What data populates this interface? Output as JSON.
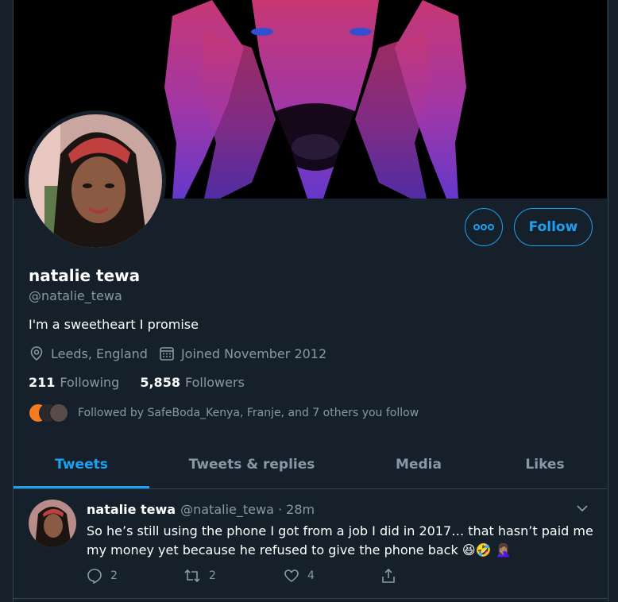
{
  "colors": {
    "accent": "#1da1f2",
    "background": "#15202b",
    "secondary_text": "#8899a6",
    "divider": "#38444d"
  },
  "profile": {
    "name": "natalie tewa",
    "handle": "@natalie_tewa",
    "bio": "I'm a sweetheart I promise",
    "location": "Leeds, England",
    "joined": "Joined November 2012",
    "following_count": "211",
    "following_label": "Following",
    "followers_count": "5,858",
    "followers_label": "Followers",
    "followed_by": "Followed by SafeBoda_Kenya, Franje, and 7 others you follow"
  },
  "buttons": {
    "follow_label": "Follow",
    "more_icon": "more-icon"
  },
  "tabs": [
    {
      "label": "Tweets",
      "active": true
    },
    {
      "label": "Tweets & replies",
      "active": false
    },
    {
      "label": "Media",
      "active": false
    },
    {
      "label": "Likes",
      "active": false
    }
  ],
  "tweet": {
    "author": "natalie tewa",
    "meta": "@natalie_tewa · 28m",
    "text": "So he’s still using the phone I got from a job I did in 2017… that hasn’t paid me my money yet because he refused to give the phone back",
    "emojis": "😆🤣 🤦🏽‍♀️",
    "replies": "2",
    "retweets": "2",
    "likes": "4"
  }
}
